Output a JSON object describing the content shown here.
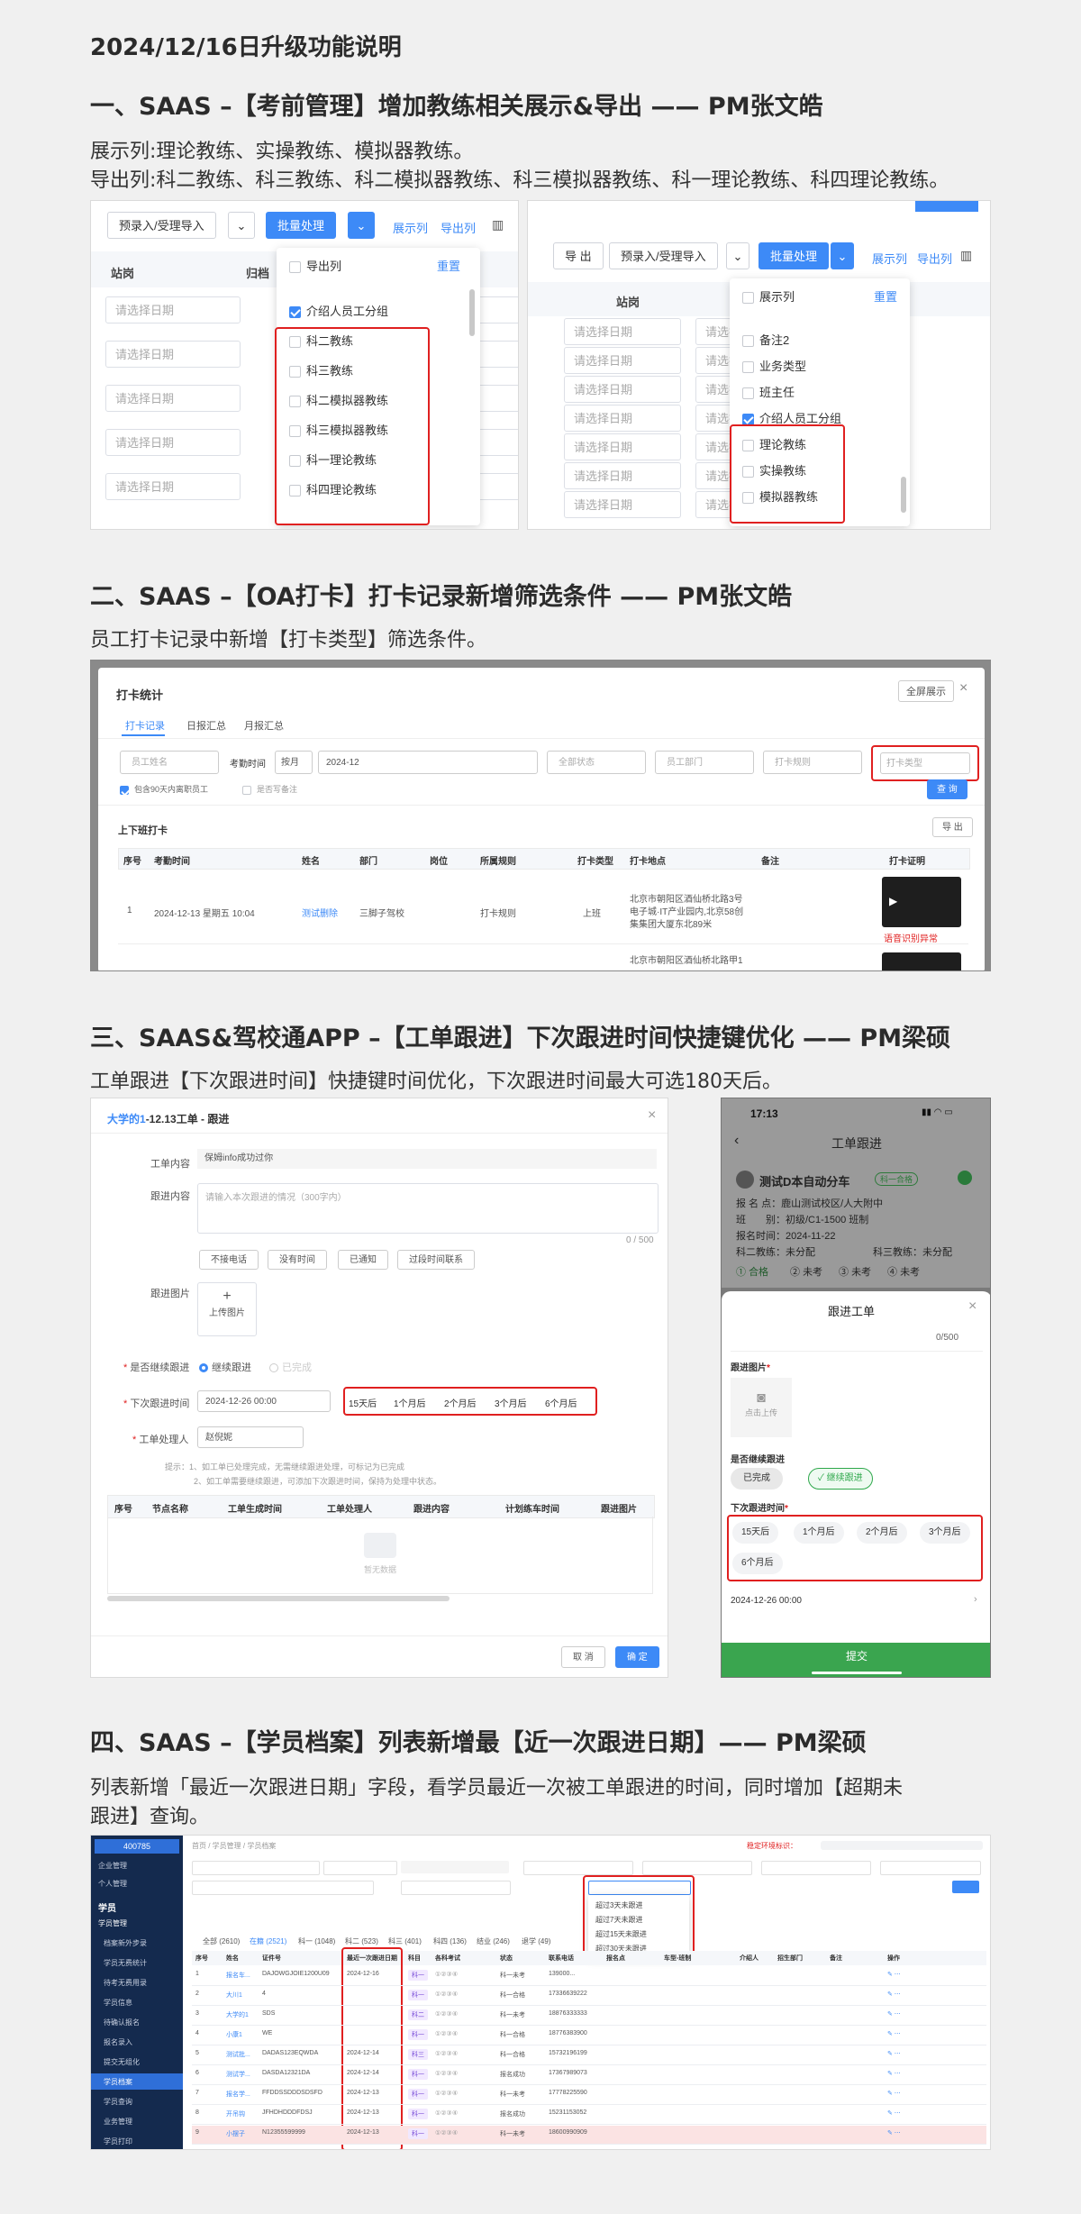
{
  "doc_title": "2024/12/16日升级功能说明",
  "sections": [
    {
      "title": "一、SAAS –【考前管理】增加教练相关展示&导出 —— PM张文皓",
      "desc": [
        "展示列:理论教练、实操教练、模拟器教练。",
        "导出列:科二教练、科三教练、科二模拟器教练、科三模拟器教练、科一理论教练、科四理论教练。"
      ]
    },
    {
      "title": "二、SAAS –【OA打卡】打卡记录新增筛选条件 —— PM张文皓",
      "desc": [
        "员工打卡记录中新增【打卡类型】筛选条件。"
      ]
    },
    {
      "title": "三、SAAS&驾校通APP –【工单跟进】下次跟进时间快捷键优化 —— PM梁硕",
      "desc": [
        "工单跟进【下次跟进时间】快捷键时间优化，下次跟进时间最大可选180天后。"
      ]
    },
    {
      "title": "四、SAAS –【学员档案】列表新增最【近一次跟进日期】—— PM梁硕",
      "desc": [
        "列表新增「最近一次跟进日期」字段，看学员最近一次被工单跟进的时间，同时增加【超期未",
        "跟进】查询。"
      ]
    }
  ],
  "s1_left": {
    "toolbar": {
      "import": "预录入/受理导入",
      "batch": "批量处理",
      "show_cols": "展示列",
      "export_cols": "导出列"
    },
    "headers": [
      "站岗",
      "归档"
    ],
    "date_placeholder": "请选择日期",
    "dropdown": {
      "title": "导出列",
      "reset": "重置",
      "items": [
        "介绍人员工分组",
        "科二教练",
        "科三教练",
        "科二模拟器教练",
        "科三模拟器教练",
        "科一理论教练",
        "科四理论教练"
      ]
    }
  },
  "s1_right": {
    "toolbar": {
      "export": "导 出",
      "import": "预录入/受理导入",
      "batch": "批量处理",
      "show_cols": "展示列",
      "export_cols": "导出列"
    },
    "header": "站岗",
    "date_placeholder": "请选择日期",
    "dropdown": {
      "title": "展示列",
      "reset": "重置",
      "items": [
        "备注2",
        "业务类型",
        "班主任",
        "介绍人员工分组",
        "理论教练",
        "实操教练",
        "模拟器教练"
      ]
    }
  },
  "s2": {
    "title": "打卡统计",
    "fullscreen": "全屏展示",
    "tabs": [
      "打卡记录",
      "日报汇总",
      "月报汇总"
    ],
    "filters": {
      "name": "员工姓名",
      "time_label": "考勤时间",
      "by_month": "按月",
      "month": "2024-12",
      "status": "全部状态",
      "dept": "员工部门",
      "rule": "打卡规则",
      "type": "打卡类型"
    },
    "checks": [
      "包含90天内离职员工",
      "是否写备注"
    ],
    "query": "查 询",
    "section": "上下班打卡",
    "export": "导 出",
    "columns": [
      "序号",
      "考勤时间",
      "姓名",
      "部门",
      "岗位",
      "所属规则",
      "打卡类型",
      "打卡地点",
      "备注",
      "打卡证明"
    ],
    "row": {
      "no": "1",
      "time": "2024-12-13 星期五 10:04",
      "name": "测试删除",
      "dept": "三脚子驾校",
      "rule": "打卡规则",
      "type": "上班",
      "addr": [
        "北京市朝阳区酒仙桥北路3号",
        "电子城·IT产业园内,北京58创",
        "集集团大厦东北89米"
      ],
      "warn": "语音识别异常",
      "addr2": "北京市朝阳区酒仙桥北路甲1"
    }
  },
  "s3_web": {
    "title_blue": "大学的1",
    "title_rest": "-12.13工单 - 跟进",
    "content_label": "工单内容",
    "content_value": "保姆info成功过你",
    "follow_label": "跟进内容",
    "follow_placeholder": "请输入本次跟进的情况（300字内）",
    "counter": "0 / 500",
    "quick_reasons": [
      "不接电话",
      "没有时间",
      "已通知",
      "过段时间联系"
    ],
    "image_label": "跟进图片",
    "upload": "上传图片",
    "continue_label": "是否继续跟进",
    "continue_yes": "继续跟进",
    "continue_no": "已完成",
    "next_label": "下次跟进时间",
    "next_value": "2024-12-26 00:00",
    "quick_times": [
      "15天后",
      "1个月后",
      "2个月后",
      "3个月后",
      "6个月后"
    ],
    "handler_label": "工单处理人",
    "handler_value": "赵倪妮",
    "tips": [
      "提示：1、如工单已处理完成，无需继续跟进处理，可标记为已完成",
      "2、如工单需要继续跟进，可添加下次跟进时间，保持为处理中状态。"
    ],
    "columns": [
      "序号",
      "节点名称",
      "工单生成时间",
      "工单处理人",
      "跟进内容",
      "计划练车时间",
      "跟进图片"
    ],
    "empty": "暂无数据",
    "cancel": "取 消",
    "ok": "确 定"
  },
  "s3_mobile": {
    "time": "17:13",
    "header": "工单跟进",
    "car": "测试D本自动分车",
    "tag": "科一合格",
    "info": [
      "报 名 点：鹿山测试校区/人大附中",
      "班　　别：初级/C1-1500 班制",
      "报名时间：2024-11-22"
    ],
    "coach_left": "科二教练：未分配",
    "coach_right": "科三教练：未分配",
    "steps": [
      "合格",
      "未考",
      "未考",
      "未考"
    ],
    "sheet_title": "跟进工单",
    "counter": "0/500",
    "img_label": "跟进图片",
    "upload": "点击上传",
    "continue_label": "是否继续跟进",
    "done": "已完成",
    "continue": "继续跟进",
    "next_label": "下次跟进时间",
    "quick_times": [
      "15天后",
      "1个月后",
      "2个月后",
      "3个月后",
      "6个月后"
    ],
    "next_value": "2024-12-26 00:00",
    "submit": "提交"
  },
  "s4": {
    "logo": "400785",
    "menu_top": [
      "企业管理",
      "个人管理"
    ],
    "menu_group": "学员",
    "menu_sub": "学员管理",
    "menu_items": [
      "档案新外步录",
      "学员无费统计",
      "待考无费用录",
      "学员信息",
      "待确认报名",
      "报名录入",
      "提交无组化",
      "学员档案",
      "学员查询",
      "业务管理",
      "学员打印"
    ],
    "breadcrumb": "首页 / 学员管理 / 学员档案",
    "top_right": "稳定环境标识：",
    "dropdown_items": [
      "超过3天未跟进",
      "超过7天未跟进",
      "超过15天未跟进",
      "超过30天未跟进"
    ],
    "tabs": [
      "全部 (2610)",
      "在籍 (2521)",
      "科一 (1048)",
      "科二 (523)",
      "科三 (401)",
      "科四 (136)",
      "结业 (246)",
      "退学 (49)"
    ],
    "columns": [
      "序号",
      "姓名",
      "证件号",
      "最近一次跟进日期",
      "科目",
      "各科考试",
      "状态",
      "联系电话",
      "报名点",
      "车型-班制",
      "介绍人",
      "招生部门",
      "备注",
      "操作"
    ],
    "rows": [
      [
        "1",
        "报名车...",
        "DAJOWGJOIE1200U09",
        "2024-12-16",
        "科一",
        "科一未考",
        "139000..."
      ],
      [
        "2",
        "大川1",
        "4",
        "",
        "科一",
        "科一合格",
        "17336639222"
      ],
      [
        "3",
        "大学的1",
        "SDS",
        "",
        "科二",
        "科一未考",
        "18876333333"
      ],
      [
        "4",
        "小康1",
        "WE",
        "",
        "科一",
        "科一合格",
        "18776383900"
      ],
      [
        "5",
        "测试批...",
        "DADAS123EQWDA",
        "2024-12-14",
        "科三",
        "科一合格",
        "15732196199"
      ],
      [
        "6",
        "测试学...",
        "DASDA12321DA",
        "2024-12-14",
        "科一",
        "报名成功",
        "17367989073"
      ],
      [
        "7",
        "报名学...",
        "FFDDSSDDDSDSFD",
        "2024-12-13",
        "科一",
        "科一未考",
        "17778225590"
      ],
      [
        "8",
        "开吊钩",
        "JFHDHDDDFDSJ",
        "2024-12-13",
        "科一",
        "报名成功",
        "15231153052"
      ],
      [
        "9",
        "小摆子",
        "N12355599999",
        "2024-12-13",
        "科一",
        "科一未考",
        "18600990909"
      ]
    ]
  }
}
